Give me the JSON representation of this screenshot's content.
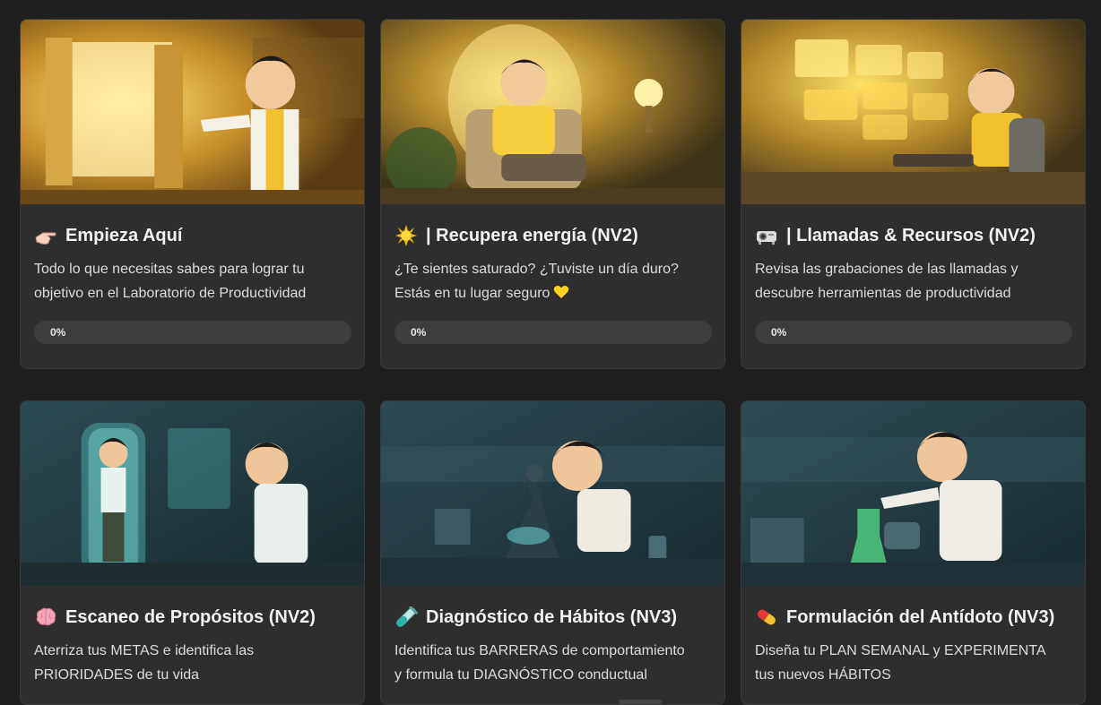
{
  "courses": [
    {
      "title": "Empieza Aquí",
      "emoji": "pointing-hand-icon",
      "description_line1": "Todo lo que necesitas sabes para lograr tu",
      "description_line2": "objetivo en el Laboratorio de Productividad",
      "progress": 0,
      "progress_label": "0%"
    },
    {
      "title": "| Recupera energía (NV2)",
      "emoji": "sun-icon",
      "description_line1": "¿Te sientes saturado? ¿Tuviste un día duro?",
      "description_line2": "Estás en tu lugar seguro",
      "trailing_emoji": "yellow-heart-icon",
      "progress": 0,
      "progress_label": "0%"
    },
    {
      "title": "| Llamadas & Recursos (NV2)",
      "emoji": "projector-icon",
      "description_line1": "Revisa las grabaciones de las llamadas y",
      "description_line2": "descubre herramientas de productividad",
      "progress": 0,
      "progress_label": "0%"
    },
    {
      "title": "Escaneo de Propósitos (NV2)",
      "emoji": "brain-icon",
      "description_line1": "Aterriza tus METAS e identifica las",
      "description_line2": "PRIORIDADES de tu vida"
    },
    {
      "title": "Diagnóstico de Hábitos (NV3)",
      "emoji": "test-tube-icon",
      "description_line1": "Identifica tus BARRERAS de comportamiento",
      "description_line2": "y formula tu DIAGNÓSTICO conductual"
    },
    {
      "title": "Formulación del Antídoto (NV3)",
      "emoji": "pill-icon",
      "description_line1": "Diseña tu PLAN SEMANAL y EXPERIMENTA",
      "description_line2": "tus nuevos HÁBITOS"
    }
  ],
  "colors": {
    "background": "#1f1f1f",
    "card": "#2e2e2e",
    "progress_track": "#3d3d3d",
    "warm_theme": "#f2c12e",
    "cool_theme": "#3fb6b0"
  }
}
